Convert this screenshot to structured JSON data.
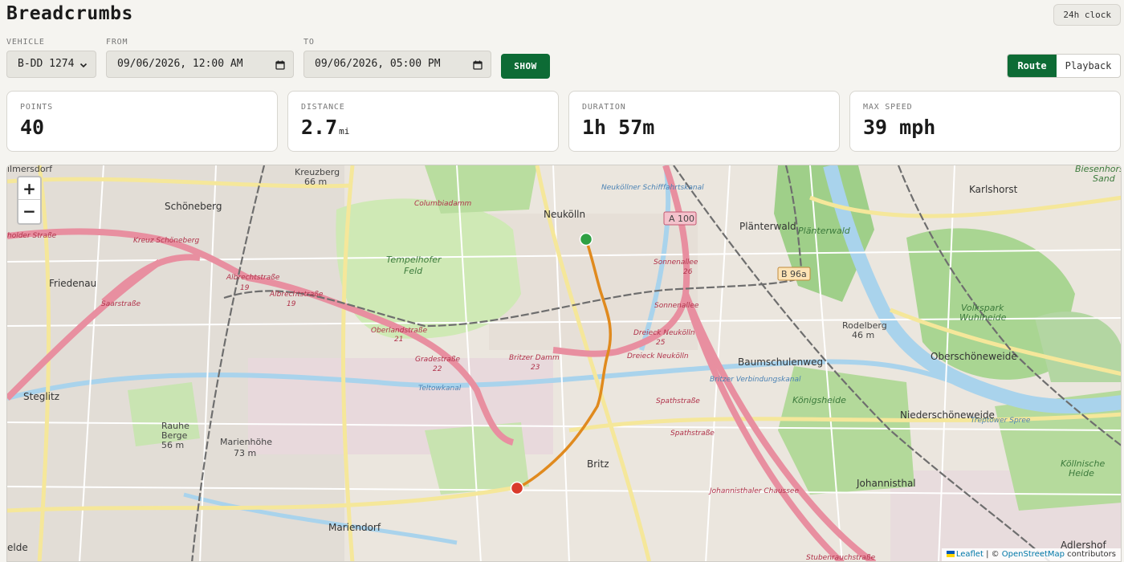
{
  "app": {
    "title": "Breadcrumbs",
    "clock_label": "24h clock"
  },
  "filters": {
    "vehicle": {
      "label": "VEHICLE",
      "value": "B-DD 1274"
    },
    "from": {
      "label": "FROM",
      "value": "09/06/2026, 12:00 AM"
    },
    "to": {
      "label": "TO",
      "value": "09/06/2026, 05:00 PM"
    },
    "show_label": "SHOW"
  },
  "view_toggle": {
    "route_label": "Route",
    "playback_label": "Playback",
    "active": "Route"
  },
  "stats": [
    {
      "label": "POINTS",
      "value": "40",
      "unit": ""
    },
    {
      "label": "DISTANCE",
      "value": "2.7",
      "unit": "mi"
    },
    {
      "label": "DURATION",
      "value": "1h 57m",
      "unit": ""
    },
    {
      "label": "MAX SPEED",
      "value": "39 mph",
      "unit": ""
    }
  ],
  "map": {
    "zoom_in": "+",
    "zoom_out": "−",
    "route_color": "#e08a1e",
    "start_color": "#2ea043",
    "end_color": "#d93a2b",
    "places": {
      "wilmersdorf": "ilmersdorf",
      "schoeneberg": "Schöneberg",
      "friedenau": "Friedenau",
      "steglitz": "Steglitz",
      "mariendorf": "Mariendorf",
      "neukoelln": "Neukölln",
      "britz": "Britz",
      "planterwald": "Plänterwald",
      "baumschulenweg": "Baumschulenweg",
      "oberschoeneweide": "Oberschöneweide",
      "niederschoeneweide": "Niederschöneweide",
      "johannisthal": "Johannisthal",
      "adlershof": "Adlershof",
      "karlshorst": "Karlshorst",
      "elde": "elde",
      "kreuzberg": "Kreuzberg",
      "kreuzberg_elev": "66 m",
      "rauhe_berge": "Rauhe",
      "rauhe_berge2": "Berge",
      "rauhe_elev": "56 m",
      "marienhoehe": "Marienhöhe",
      "marienhoehe_elev": "73 m",
      "tempelhofer": "Tempelhofer",
      "feld": "Feld",
      "planterwald_park": "Plänterwald",
      "rodelberg": "Rodelberg",
      "rodelberg_elev": "46 m",
      "volkspark": "Volkspark",
      "wuhlheide": "Wuhlheide",
      "koenigsheide": "Königsheide",
      "koellnische": "Köllnische",
      "heide": "Heide",
      "biesenhorster": "Biesenhorster",
      "sand": "Sand"
    },
    "roads": {
      "a100": "A 100",
      "b96a": "B 96a",
      "kreuz_schoeneberg": "Kreuz Schöneberg",
      "albrechtstr": "Albrechtstraße",
      "albrechtstr_num": "19",
      "saarstrasse": "Saarstraße",
      "oberlandstrasse": "Oberlandstraße",
      "oberlandstrasse_num": "21",
      "gradestrasse": "Gradestraße",
      "gradestrasse_num": "22",
      "britzer_damm": "Britzer Damm",
      "britzer_damm_num": "23",
      "dreieck_neukoelln": "Dreieck Neukölln",
      "dreieck_num": "25",
      "sonnenallee": "Sonnenallee",
      "sonnenallee_num": "26",
      "spathstrasse": "Spathstraße",
      "johannisthaler": "Johannisthaler Chaussee",
      "stubenrauch": "Stubenrauchstraße",
      "columbiadamm": "Columbiadamm",
      "holder": "holder Straße",
      "teltowkanal": "Teltowkanal",
      "britzer_kanal": "Britzer Verbindungskanal",
      "neukoellner_kanal": "Neuköllner Schifffahrtskanal",
      "spree": "Treptower Spree"
    },
    "attribution": {
      "leaflet": "Leaflet",
      "separator": " | © ",
      "osm": "OpenStreetMap",
      "suffix": " contributors"
    }
  }
}
